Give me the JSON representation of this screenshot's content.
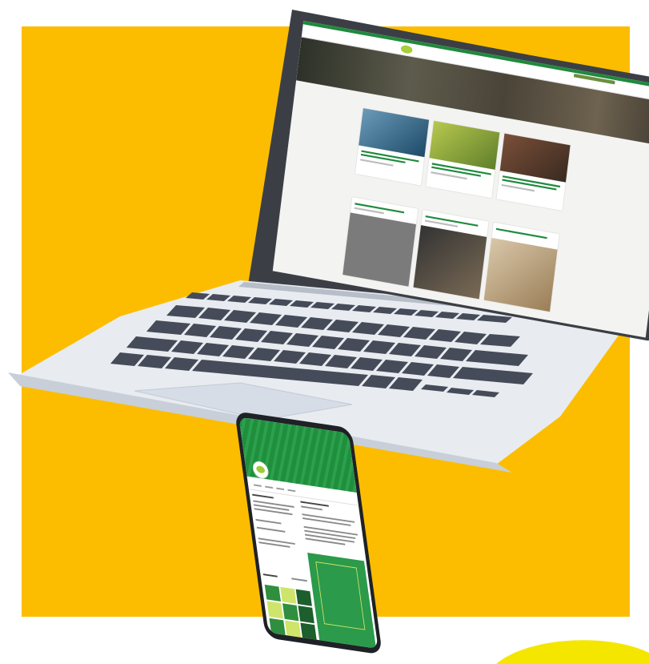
{
  "colors": {
    "background": "#ffffff",
    "panel_yellow": "#fcbd00",
    "accent_green": "#1f8a3d",
    "highlight_yellow": "#f5e600",
    "laptop_body": "#e6eaf0",
    "key_dark": "#454b58"
  },
  "laptop_screen": {
    "hero_headline": "",
    "nav_items": [
      "",
      "",
      "",
      "",
      "",
      "",
      ""
    ],
    "section1_title": "",
    "section2_title": ""
  },
  "phone_screen": {
    "header_title": "",
    "page_name": "",
    "page_subtitle": "",
    "poster_title": ""
  }
}
